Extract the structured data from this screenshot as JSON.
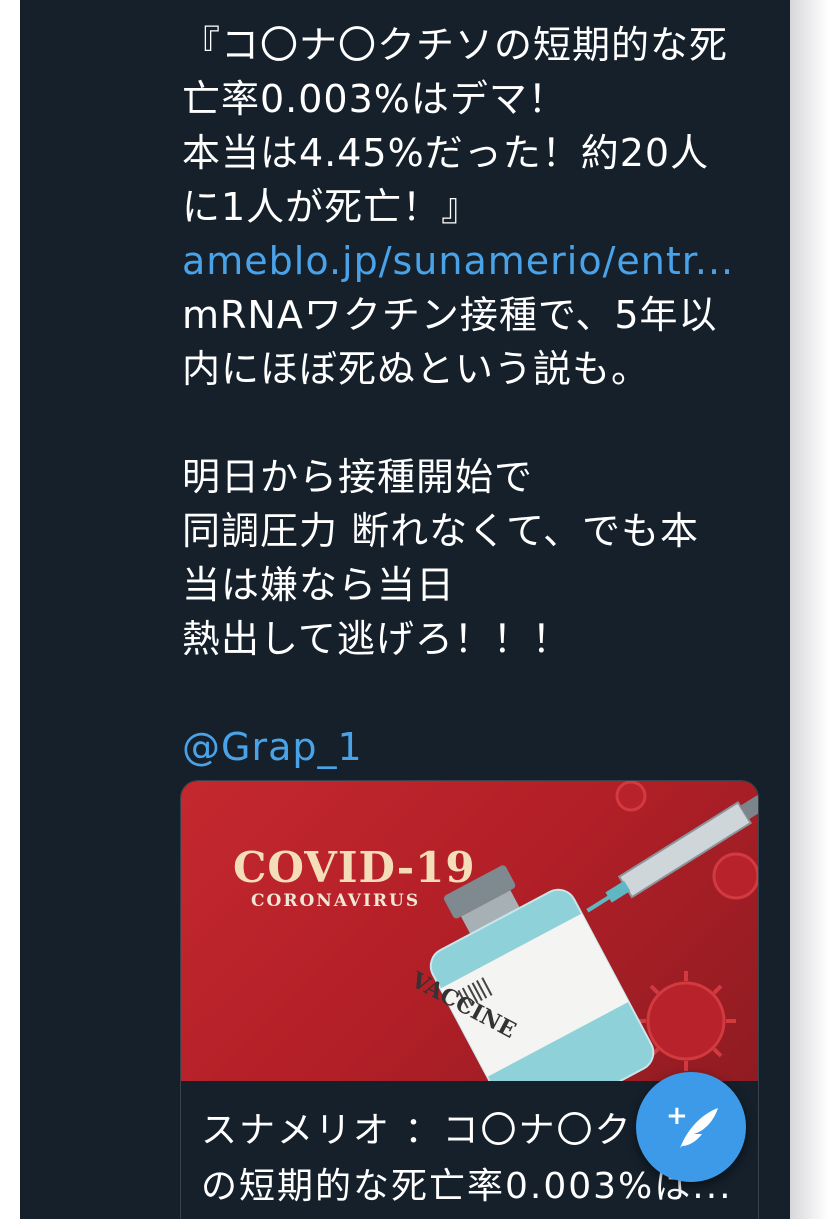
{
  "tweet": {
    "lines": [
      "『コ〇ナ〇クチソの短期的な死",
      "亡率0.003%はデマ！",
      "本当は4.45%だった！約20人",
      "に1人が死亡！』"
    ],
    "link": "ameblo.jp/sunamerio/entr...",
    "lines2": [
      "mRNAワクチン接種で、5年以",
      "内にほぼ死ぬという説も。"
    ],
    "lines3": [
      "明日から接種開始で",
      "同調圧力 断れなくて、でも本",
      "当は嫌なら当日",
      "熱出して逃げろ！！！"
    ],
    "mention": "@Grap_1"
  },
  "card": {
    "image_title": "COVID-19",
    "image_subtitle": "CORONAVIRUS",
    "vial_label": "VACCINE",
    "caption_line1": "スナメリオ ：コ〇ナ〇ク",
    "caption_line2": "の短期的な死亡率0.003%は..."
  },
  "fab": {
    "icon": "compose-tweet-icon"
  },
  "colors": {
    "background": "#15202b",
    "link": "#4aa3e8",
    "fab": "#3d9ae8"
  }
}
